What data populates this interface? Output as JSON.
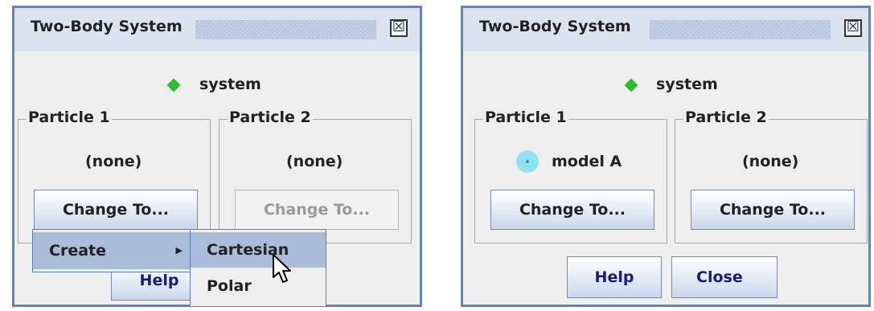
{
  "left_window": {
    "title": "Two-Body System",
    "close_glyph": "☒",
    "system_label": "system",
    "particle1": {
      "title": "Particle 1",
      "value": "(none)",
      "button": "Change To..."
    },
    "particle2": {
      "title": "Particle 2",
      "value": "(none)",
      "button": "Change To..."
    },
    "help_button": "Help",
    "menu": {
      "create_label": "Create",
      "submenu_arrow": "▶"
    },
    "submenu": {
      "items": [
        "Cartesian",
        "Polar"
      ],
      "highlighted": "Cartesian"
    }
  },
  "right_window": {
    "title": "Two-Body System",
    "close_glyph": "☒",
    "system_label": "system",
    "particle1": {
      "title": "Particle 1",
      "value": "model A",
      "button": "Change To..."
    },
    "particle2": {
      "title": "Particle 2",
      "value": "(none)",
      "button": "Change To..."
    },
    "help_button": "Help",
    "close_button": "Close"
  },
  "colors": {
    "window_border": "#6382bf",
    "system_indicator": "#2ebd2e",
    "particle_indicator": "#8fe3f0",
    "menu_highlight": "#a9bcd8"
  },
  "icons": [
    "close-icon",
    "system-diamond-icon",
    "submenu-arrow-icon",
    "particle-circle-icon",
    "mouse-cursor-icon"
  ]
}
